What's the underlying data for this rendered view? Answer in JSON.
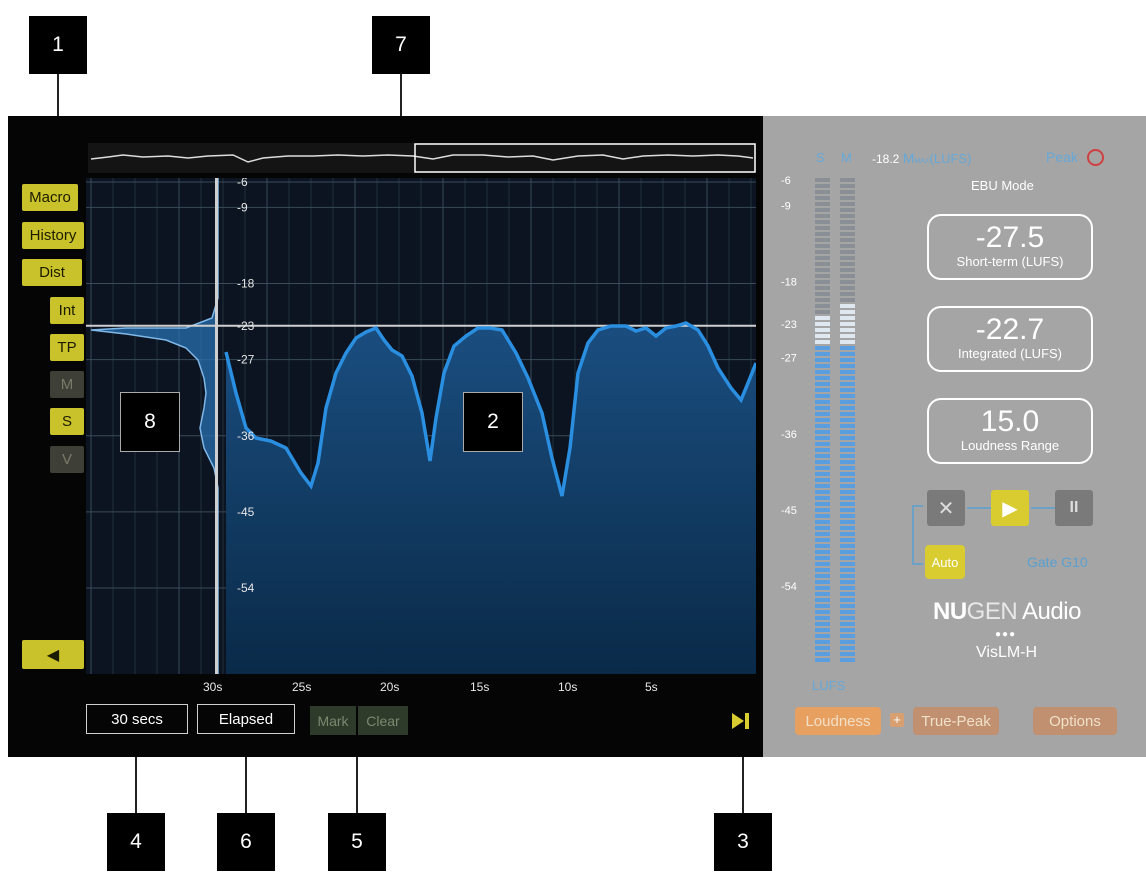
{
  "callouts": {
    "c1": "1",
    "c7": "7",
    "c4": "4",
    "c6": "6",
    "c5": "5",
    "c3": "3",
    "c8": "8",
    "c2": "2"
  },
  "side_buttons": {
    "macro": "Macro",
    "history": "History",
    "dist": "Dist",
    "int": "Int",
    "tp": "TP",
    "m": "M",
    "s": "S",
    "v": "V"
  },
  "graph": {
    "y_ticks": [
      "-6",
      "-9",
      "-18",
      "-23",
      "-27",
      "-36",
      "-45",
      "-54"
    ],
    "x_ticks": [
      "30s",
      "25s",
      "20s",
      "15s",
      "10s",
      "5s"
    ],
    "reference_level": -23
  },
  "bottom": {
    "duration": "30 secs",
    "time_mode": "Elapsed",
    "mark": "Mark",
    "clear": "Clear"
  },
  "meter": {
    "s_label": "S",
    "m_label": "M",
    "scale_label": "LUFS",
    "ticks": [
      "-6",
      "-9",
      "-18",
      "-23",
      "-27",
      "-36",
      "-45",
      "-54"
    ],
    "s_level": -22,
    "m_level": -20,
    "max_value": "-18.2",
    "max_m": "M",
    "max_sub": "MAX",
    "max_unit": "(LUFS)",
    "peak_label": "Peak",
    "mode": "EBU Mode"
  },
  "readouts": {
    "short_term": {
      "value": "-27.5",
      "label": "Short-term (LUFS)"
    },
    "integrated": {
      "value": "-22.7",
      "label": "Integrated (LUFS)"
    },
    "range": {
      "value": "15.0",
      "label": "Loudness Range"
    }
  },
  "controls": {
    "reset_icon": "x-icon",
    "play_icon": "play-icon",
    "pause_icon": "pause-icon",
    "auto": "Auto",
    "gate": "Gate G10"
  },
  "brand": {
    "nu": "NU",
    "gen": "GEN",
    "audio": " Audio",
    "product": "VisLM-H"
  },
  "footer": {
    "loudness": "Loudness",
    "plus": "+",
    "true_peak": "True-Peak",
    "options": "Options"
  },
  "colors": {
    "accent_yellow": "#c9c22a",
    "curve_blue": "#2a8fe0",
    "panel_gray": "#a5a5a5",
    "orange": "#e8a060"
  }
}
